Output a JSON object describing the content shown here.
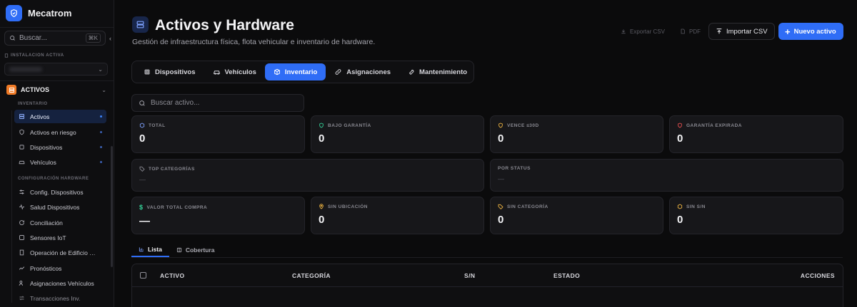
{
  "brand": {
    "name": "Mecatrom"
  },
  "sidebar": {
    "search": {
      "placeholder": "Buscar...",
      "shortcut": "⌘K"
    },
    "installation": {
      "label": "INSTALACION ACTIVA"
    },
    "group": {
      "title": "ACTIVOS"
    },
    "sections": [
      {
        "label": "INVENTARIO"
      },
      {
        "label": "CONFIGURACIÓN HARDWARE"
      }
    ],
    "items": [
      {
        "label": "Activos",
        "active": true
      },
      {
        "label": "Activos en riesgo"
      },
      {
        "label": "Dispositivos"
      },
      {
        "label": "Vehículos"
      },
      {
        "label": "Config. Dispositivos"
      },
      {
        "label": "Salud Dispositivos"
      },
      {
        "label": "Conciliación"
      },
      {
        "label": "Sensores IoT"
      },
      {
        "label": "Operación de Edificio (..."
      },
      {
        "label": "Pronósticos"
      },
      {
        "label": "Asignaciones Vehículos"
      },
      {
        "label": "Transacciones Inv."
      }
    ]
  },
  "header": {
    "title": "Activos y Hardware",
    "subtitle": "Gestión de infraestructura física, flota vehicular e inventario de hardware.",
    "export_csv": "Exportar CSV",
    "pdf": "PDF",
    "import_csv": "Importar CSV",
    "new_asset": "Nuevo activo"
  },
  "tabs": [
    {
      "label": "Dispositivos"
    },
    {
      "label": "Vehículos"
    },
    {
      "label": "Inventario",
      "active": true
    },
    {
      "label": "Asignaciones"
    },
    {
      "label": "Mantenimiento"
    }
  ],
  "search": {
    "placeholder": "Buscar activo..."
  },
  "stats": {
    "total": {
      "label": "TOTAL",
      "value": "0"
    },
    "warranty": {
      "label": "BAJO GARANTÍA",
      "value": "0"
    },
    "expiring": {
      "label": "VENCE ≤30D",
      "value": "0"
    },
    "expired": {
      "label": "GARANTÍA EXPIRADA",
      "value": "0"
    },
    "top_categories": {
      "label": "TOP CATEGORÍAS",
      "value": "—"
    },
    "by_status": {
      "label": "POR STATUS",
      "value": "—"
    },
    "purchase_value": {
      "label": "VALOR TOTAL COMPRA",
      "value": "—"
    },
    "no_location": {
      "label": "SIN UBICACIÓN",
      "value": "0"
    },
    "no_category": {
      "label": "SIN CATEGORÍA",
      "value": "0"
    },
    "no_serial": {
      "label": "SIN S/N",
      "value": "0"
    }
  },
  "sub_tabs": [
    {
      "label": "Lista",
      "active": true
    },
    {
      "label": "Cobertura"
    }
  ],
  "table": {
    "columns": [
      "ACTIVO",
      "CATEGORÍA",
      "S/N",
      "ESTADO",
      "ACCIONES"
    ]
  },
  "colors": {
    "accent": "#2f6df6",
    "orange": "#f07a26",
    "background": "#0b0b0c"
  }
}
